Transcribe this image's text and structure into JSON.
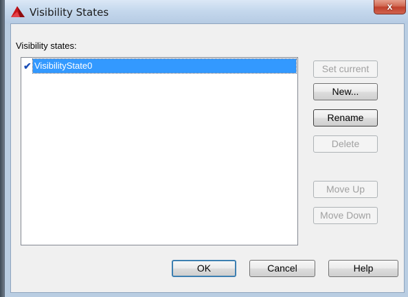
{
  "window": {
    "title": "Visibility States",
    "close_glyph": "x",
    "app_icon": "autocad-icon"
  },
  "panel": {
    "label": "Visibility states:"
  },
  "list": {
    "items": [
      {
        "label": "VisibilityState0",
        "checked": true,
        "check_glyph": "✔",
        "selected": true
      }
    ]
  },
  "side_buttons": {
    "set_current": "Set current",
    "new": "New...",
    "rename": "Rename",
    "delete": "Delete",
    "move_up": "Move Up",
    "move_down": "Move Down"
  },
  "footer_buttons": {
    "ok": "OK",
    "cancel": "Cancel",
    "help": "Help"
  },
  "colors": {
    "selection": "#3399ff",
    "check": "#1c4fb6",
    "close": "#c0412c"
  }
}
